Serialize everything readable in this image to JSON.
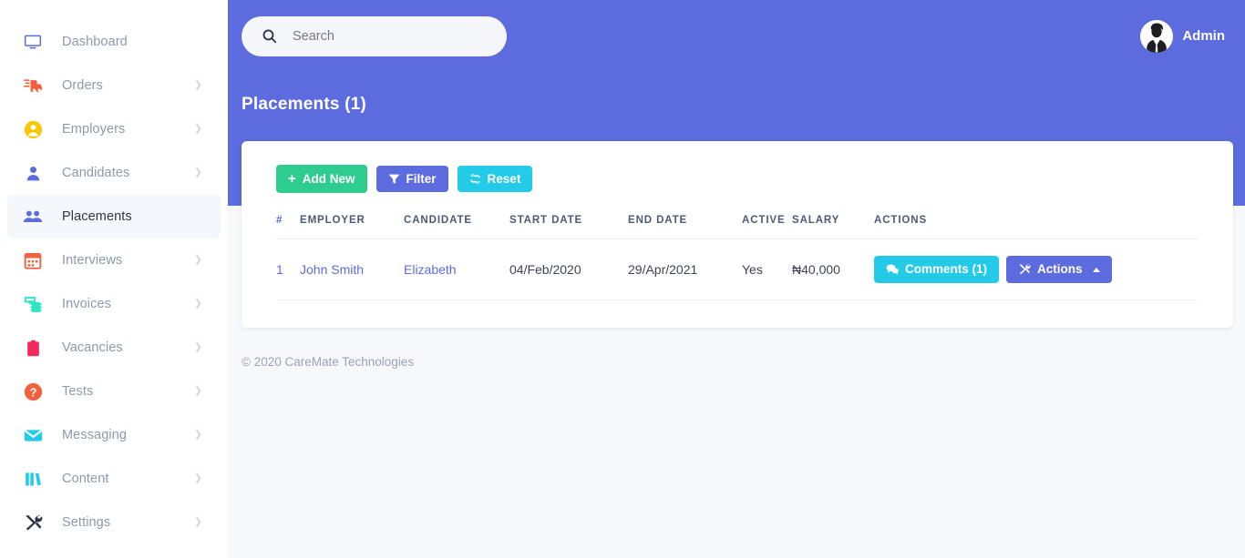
{
  "sidebar": {
    "items": [
      {
        "label": "Dashboard",
        "icon": "monitor-icon",
        "color": "#5c6bdd",
        "chevron": false,
        "active": false
      },
      {
        "label": "Orders",
        "icon": "shipping-icon",
        "color": "#f4603e",
        "chevron": true,
        "active": false
      },
      {
        "label": "Employers",
        "icon": "user-circle-icon",
        "color": "#f7c800",
        "chevron": true,
        "active": false
      },
      {
        "label": "Candidates",
        "icon": "user-icon",
        "color": "#5c6bdd",
        "chevron": true,
        "active": false
      },
      {
        "label": "Placements",
        "icon": "users-icon",
        "color": "#5c6bdd",
        "chevron": false,
        "active": true
      },
      {
        "label": "Interviews",
        "icon": "calendar-icon",
        "color": "#f4603e",
        "chevron": true,
        "active": false
      },
      {
        "label": "Invoices",
        "icon": "money-icon",
        "color": "#2ee6c5",
        "chevron": true,
        "active": false
      },
      {
        "label": "Vacancies",
        "icon": "clipboard-icon",
        "color": "#f2295b",
        "chevron": true,
        "active": false
      },
      {
        "label": "Tests",
        "icon": "question-circle-icon",
        "color": "#f4603e",
        "chevron": true,
        "active": false
      },
      {
        "label": "Messaging",
        "icon": "envelope-icon",
        "color": "#24cbe8",
        "chevron": true,
        "active": false
      },
      {
        "label": "Content",
        "icon": "books-icon",
        "color": "#24cbe8",
        "chevron": true,
        "active": false
      },
      {
        "label": "Settings",
        "icon": "tools-icon",
        "color": "#2f3545",
        "chevron": true,
        "active": false
      }
    ]
  },
  "topbar": {
    "search": {
      "placeholder": "Search",
      "value": "",
      "icon": "search-icon"
    },
    "profile": {
      "name": "Admin",
      "avatar_icon": "user-avatar-icon"
    }
  },
  "page": {
    "title": "Placements (1)",
    "toolbar": {
      "add_new": {
        "label": "Add New",
        "icon": "plus-icon",
        "color": "#2ecc8f"
      },
      "filter": {
        "label": "Filter",
        "icon": "funnel-icon",
        "color": "#5c6bdd"
      },
      "reset": {
        "label": "Reset",
        "icon": "refresh-icon",
        "color": "#24cbe8"
      }
    },
    "table": {
      "columns": [
        "#",
        "EMPLOYER",
        "CANDIDATE",
        "START DATE",
        "END DATE",
        "ACTIVE",
        "SALARY",
        "ACTIONS"
      ],
      "rows": [
        {
          "num": "1",
          "employer": "John Smith",
          "candidate": "Elizabeth",
          "start_date": "04/Feb/2020",
          "end_date": "29/Apr/2021",
          "active": "Yes",
          "salary": "₦40,000",
          "comments_label": "Comments (1)",
          "actions_label": "Actions"
        }
      ]
    }
  },
  "footer": {
    "copyright": "© 2020 CareMate Technologies"
  },
  "theme": {
    "purple": "#5c6bdd",
    "green": "#2ecc8f",
    "cyan": "#24cbe8",
    "page_bg": "#f7f8fc",
    "sidebar_bg": "#ffffff"
  }
}
